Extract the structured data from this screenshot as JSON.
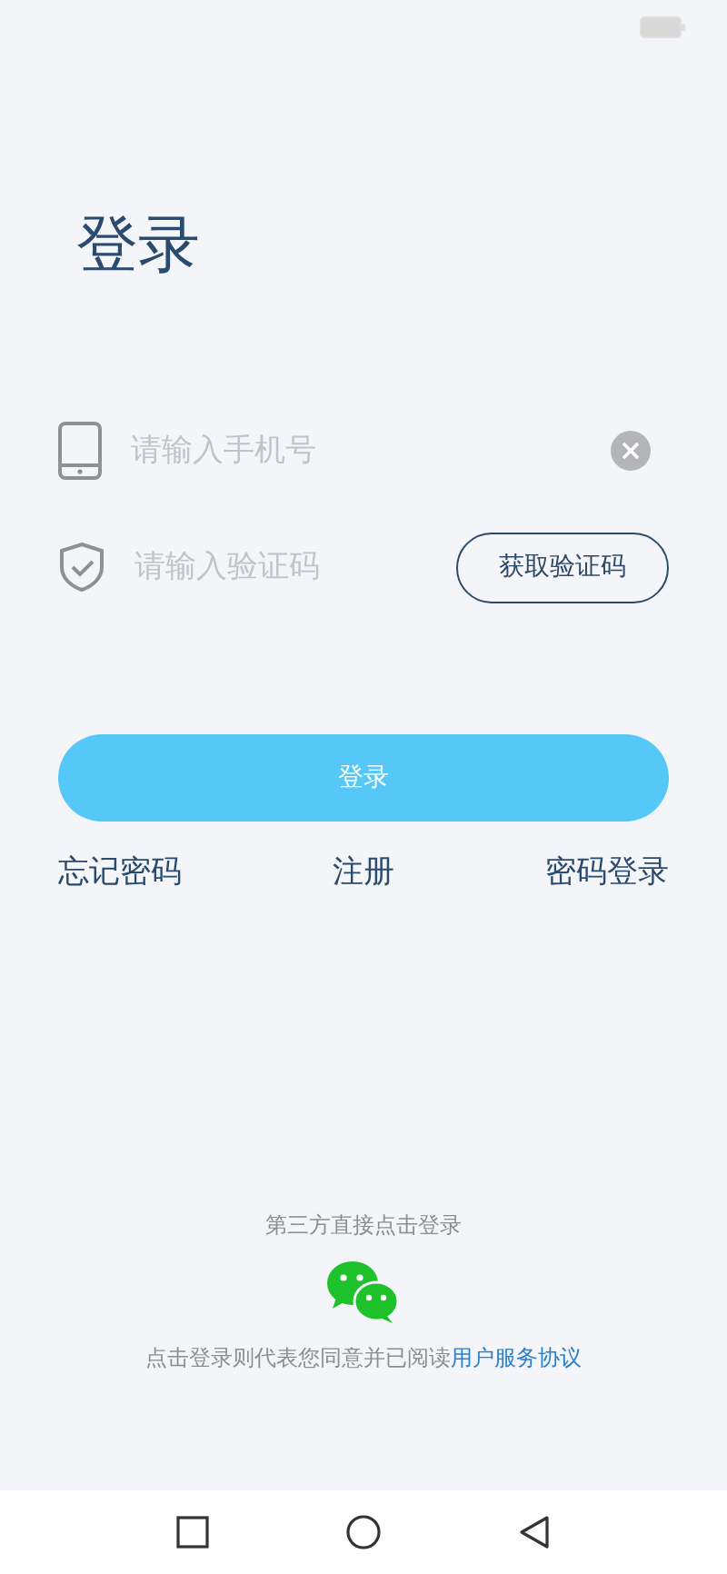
{
  "title": "登录",
  "phone_field": {
    "placeholder": "请输入手机号"
  },
  "code_field": {
    "placeholder": "请输入验证码"
  },
  "code_button": "获取验证码",
  "login_button": "登录",
  "links": [
    "忘记密码",
    "注册",
    "密码登录"
  ],
  "third_party": {
    "label": "第三方直接点击登录"
  },
  "agreement": {
    "text": "点击登录则代表您同意并已阅读",
    "link": "用户服务协议"
  }
}
